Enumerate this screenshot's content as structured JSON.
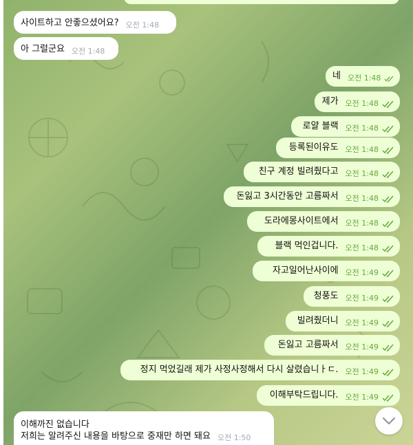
{
  "colors": {
    "incoming_bubble": "#ffffff",
    "outgoing_bubble": "#eefed5",
    "outgoing_time": "#67a83f",
    "incoming_time": "#a1aab3"
  },
  "messages": [
    {
      "dir": "in",
      "text": "사이트하고 안좋으셨어요?",
      "time": "오전 1:48"
    },
    {
      "dir": "in",
      "text": "아 그럴군요",
      "time": "오전 1:48"
    },
    {
      "dir": "out",
      "text": "네",
      "time": "오전 1:48",
      "status": "read-double-check-icon"
    },
    {
      "dir": "out",
      "text": "제가",
      "time": "오전 1:48",
      "status": "read-double-check-icon"
    },
    {
      "dir": "out",
      "text": "로얄 블랙",
      "time": "오전 1:48",
      "status": "read-double-check-icon"
    },
    {
      "dir": "out",
      "text": "등록된이유도",
      "time": "오전 1:48",
      "status": "read-double-check-icon"
    },
    {
      "dir": "out",
      "text": "친구 계정 빌려줬다고",
      "time": "오전 1:48",
      "status": "read-double-check-icon"
    },
    {
      "dir": "out",
      "text": "돈잃고 3시간동안 고름짜서",
      "time": "오전 1:48",
      "status": "read-double-check-icon"
    },
    {
      "dir": "out",
      "text": "도라에몽사이트에서",
      "time": "오전 1:48",
      "status": "read-double-check-icon"
    },
    {
      "dir": "out",
      "text": "블랙 먹인겁니다.",
      "time": "오전 1:48",
      "status": "read-double-check-icon"
    },
    {
      "dir": "out",
      "text": "자고일어난사이에",
      "time": "오전 1:49",
      "status": "read-double-check-icon"
    },
    {
      "dir": "out",
      "text": "청풍도",
      "time": "오전 1:49",
      "status": "read-double-check-icon"
    },
    {
      "dir": "out",
      "text": "빌려줬더니",
      "time": "오전 1:49",
      "status": "read-double-check-icon"
    },
    {
      "dir": "out",
      "text": "돈잃고 고름짜서",
      "time": "오전 1:49",
      "status": "read-double-check-icon"
    },
    {
      "dir": "out",
      "text": "정지 먹었길래 제가 사정사정해서 다시 살렸습니ㅏㄷ.",
      "time": "오전 1:49",
      "status": "read-double-check-icon"
    },
    {
      "dir": "out",
      "text": "이해부탁드립니다.",
      "time": "오전 1:49",
      "status": "read-double-check-icon"
    },
    {
      "dir": "in",
      "text": "이해까진 없습니다",
      "text2": "저희는 알려주신 내용을 바탕으로 중재만 하면 돼요",
      "time": "오전 1:50"
    }
  ],
  "scroll_button": {
    "icon": "chevron-down-icon"
  }
}
